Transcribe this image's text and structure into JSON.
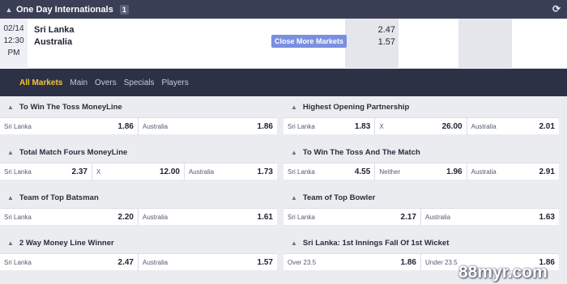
{
  "header": {
    "title": "One Day Internationals",
    "count": "1",
    "chevron_icon": "chevron-up-icon",
    "refresh_icon": "refresh-icon"
  },
  "event": {
    "date": "02/14",
    "time": "12:30",
    "ampm": "PM",
    "team1": "Sri Lanka",
    "team2": "Australia",
    "odd1": "2.47",
    "odd2": "1.57",
    "more_button": "Close More Markets"
  },
  "tabs": [
    "All Markets",
    "Main",
    "Overs",
    "Specials",
    "Players"
  ],
  "markets_left": [
    {
      "title": "To Win The Toss MoneyLine",
      "cells": [
        {
          "label": "Sri Lanka",
          "value": "1.86"
        },
        {
          "label": "Australia",
          "value": "1.86"
        }
      ]
    },
    {
      "title": "Total Match Fours MoneyLine",
      "cells": [
        {
          "label": "Sri Lanka",
          "value": "2.37"
        },
        {
          "label": "X",
          "value": "12.00"
        },
        {
          "label": "Australia",
          "value": "1.73"
        }
      ]
    },
    {
      "title": "Team of Top Batsman",
      "cells": [
        {
          "label": "Sri Lanka",
          "value": "2.20"
        },
        {
          "label": "Australia",
          "value": "1.61"
        }
      ]
    },
    {
      "title": "2 Way Money Line Winner",
      "cells": [
        {
          "label": "Sri Lanka",
          "value": "2.47"
        },
        {
          "label": "Australia",
          "value": "1.57"
        }
      ]
    }
  ],
  "markets_right": [
    {
      "title": "Highest Opening Partnership",
      "cells": [
        {
          "label": "Sri Lanka",
          "value": "1.83"
        },
        {
          "label": "X",
          "value": "26.00"
        },
        {
          "label": "Australia",
          "value": "2.01"
        }
      ]
    },
    {
      "title": "To Win The Toss And The Match",
      "cells": [
        {
          "label": "Sri Lanka",
          "value": "4.55"
        },
        {
          "label": "Neither",
          "value": "1.96"
        },
        {
          "label": "Australia",
          "value": "2.91"
        }
      ]
    },
    {
      "title": "Team of Top Bowler",
      "cells": [
        {
          "label": "Sri Lanka",
          "value": "2.17"
        },
        {
          "label": "Australia",
          "value": "1.63"
        }
      ]
    },
    {
      "title": "Sri Lanka: 1st Innings Fall Of 1st Wicket",
      "cells": [
        {
          "label": "Over 23.5",
          "value": "1.86"
        },
        {
          "label": "Under 23.5",
          "value": "1.86"
        }
      ]
    }
  ],
  "watermark": "88myr.com"
}
